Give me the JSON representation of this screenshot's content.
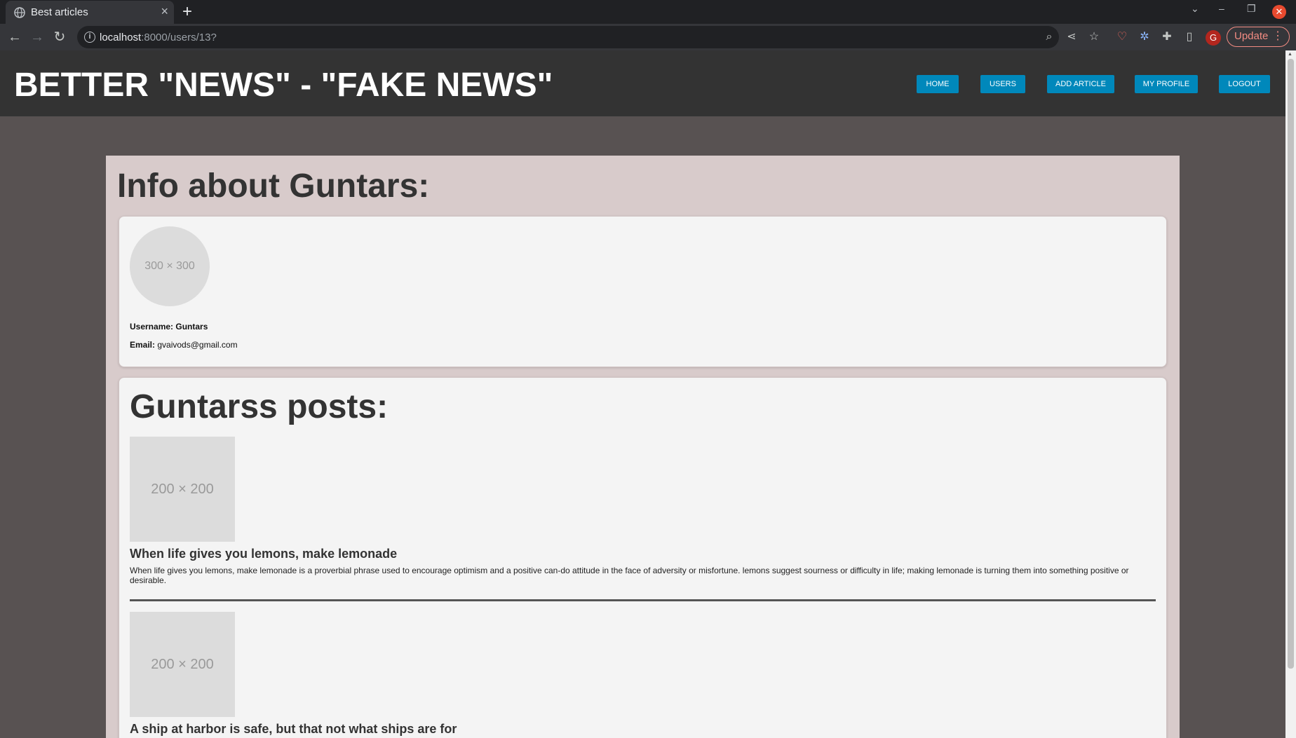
{
  "browser": {
    "tab_title": "Best articles",
    "url_host": "localhost",
    "url_path": ":8000/users/13?",
    "update_label": "Update",
    "profile_initial": "G"
  },
  "site": {
    "title": "BETTER \"NEWS\" - \"FAKE NEWS\"",
    "nav": [
      "HOME",
      "USERS",
      "ADD ARTICLE",
      "MY PROFILE",
      "LOGOUT"
    ]
  },
  "profile": {
    "heading": "Info about Guntars:",
    "avatar_placeholder": "300 × 300",
    "username_label": "Username:",
    "username": "Guntars",
    "email_label": "Email:",
    "email": "gvaivods@gmail.com"
  },
  "posts": {
    "heading": "Guntarss posts:",
    "items": [
      {
        "thumb": "200 × 200",
        "title": "When life gives you lemons, make lemonade",
        "body": "When life gives you lemons, make lemonade is a proverbial phrase used to encourage optimism and a positive can-do attitude in the face of adversity or misfortune. lemons suggest sourness or difficulty in life; making lemonade is turning them into something positive or desirable."
      },
      {
        "thumb": "200 × 200",
        "title": "A ship at harbor is safe, but that not what ships are for",
        "body": ""
      }
    ]
  },
  "colors": {
    "page_bg": "#585252",
    "header_bg": "#333333",
    "nav_button": "#0088bb",
    "container_bg": "#d8cbcb",
    "card_bg": "#f4f4f4"
  }
}
